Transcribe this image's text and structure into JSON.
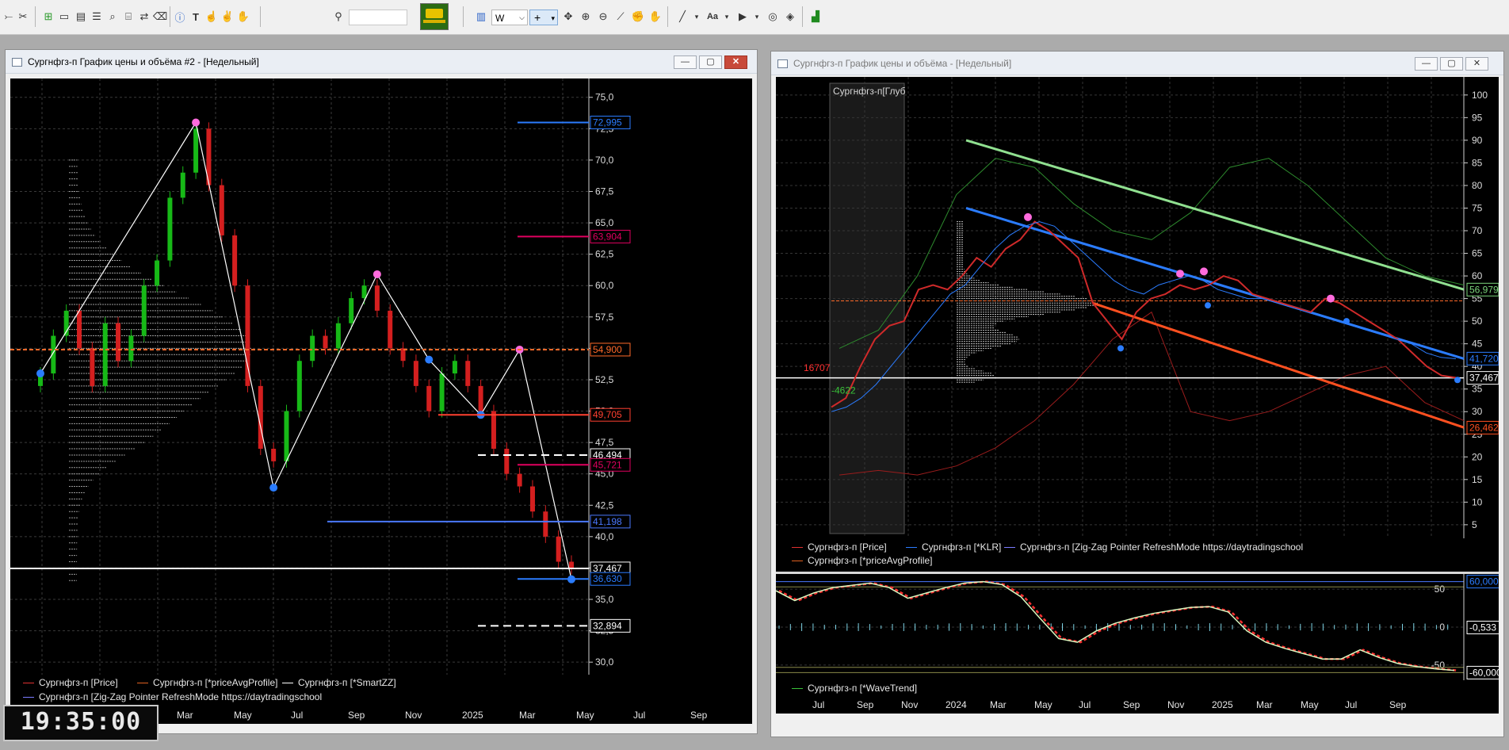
{
  "toolbar": {
    "period_value": "W",
    "icons": [
      "cursor-arrow-icon",
      "zigzag-tool-icon",
      "add-chart-icon",
      "chart-window-icon",
      "table-window-icon",
      "list-window-icon",
      "search-scan-icon",
      "script-icon",
      "transfer-icon",
      "delete-icon",
      "alert-icon",
      "text-tool-icon",
      "hand-icon",
      "fingers-icon",
      "crosshair-hand-icon",
      "search-icon",
      "ticker-image-icon",
      "bar-chart-icon",
      "crosshair-icon",
      "move-icon",
      "zoom-in-icon",
      "zoom-out-icon",
      "ruler-icon",
      "hand-grab-icon",
      "pan-icon",
      "line-tool-icon",
      "font-icon",
      "play-icon",
      "visibility-icon",
      "layers-icon",
      "indicator-icon"
    ]
  },
  "window_left": {
    "title": "Сургнфгз-п График цены и объёма #2 - [Недельный]",
    "price_ticks": [
      "75,0",
      "72,5",
      "70,0",
      "67,5",
      "65,0",
      "62,5",
      "60,0",
      "57,5",
      "55,0",
      "52,5",
      "50,0",
      "47,5",
      "45,0",
      "42,5",
      "40,0",
      "37,5",
      "35,0",
      "32,5",
      "30,0"
    ],
    "badges": [
      {
        "text": "72,995",
        "color": "#2b7cff",
        "value": 72.995
      },
      {
        "text": "63,904",
        "color": "#e0005f",
        "value": 63.904
      },
      {
        "text": "54,900",
        "color": "#ff6a2a",
        "value": 54.9
      },
      {
        "text": "49,705",
        "color": "#ff4030",
        "value": 49.705
      },
      {
        "text": "46,494",
        "color": "#ffffff",
        "value": 46.494
      },
      {
        "text": "45,721",
        "color": "#e0005f",
        "value": 45.721
      },
      {
        "text": "41,198",
        "color": "#4a78ff",
        "value": 41.198
      },
      {
        "text": "37,467",
        "color": "#ffffff",
        "value": 37.467
      },
      {
        "text": "36,630",
        "color": "#2b7cff",
        "value": 36.63
      },
      {
        "text": "32,894",
        "color": "#ffffff",
        "value": 32.894
      }
    ],
    "time_labels": [
      "Mar",
      "May",
      "Jul",
      "Sep",
      "Nov",
      "2025",
      "Mar",
      "May",
      "Jul",
      "Sep"
    ],
    "legend": [
      {
        "text": "Сургнфгз-п [Price]",
        "color": "#e03030"
      },
      {
        "text": "Сургнфгз-п [*priceAvgProfile]",
        "color": "#e06020"
      },
      {
        "text": "Сургнфгз-п [*SmartZZ]",
        "color": "#ffffff"
      },
      {
        "text": "Сургнфгз-п [Zig-Zag Pointer RefreshMode https://daytradingschool",
        "color": "#7a7aff"
      }
    ]
  },
  "window_right": {
    "title": "Сургнфгз-п График цены и объёма - [Недельный]",
    "depth_label": "Сургнфгз-п[Глуб",
    "price_ticks": [
      "100",
      "95",
      "90",
      "85",
      "80",
      "75",
      "70",
      "65",
      "60",
      "55",
      "50",
      "45",
      "40",
      "35",
      "30",
      "25",
      "20",
      "15",
      "10",
      "5"
    ],
    "badges": [
      {
        "text": "56,979",
        "color": "#7cd67c",
        "value": 56.979
      },
      {
        "text": "41,720",
        "color": "#2b7cff",
        "value": 41.72
      },
      {
        "text": "37,467",
        "color": "#ffffff",
        "value": 37.467
      },
      {
        "text": "26,462",
        "color": "#ff5020",
        "value": 26.462
      }
    ],
    "volume_labels": [
      {
        "text": "16707",
        "color": "#ff3030"
      },
      {
        "text": "-4622",
        "color": "#39c239"
      }
    ],
    "legend": [
      {
        "text": "Сургнфгз-п [Price]",
        "color": "#e03030"
      },
      {
        "text": "Сургнфгз-п [*KLR]",
        "color": "#2b7cff"
      },
      {
        "text": "Сургнфгз-п [Zig-Zag Pointer RefreshMode https://daytradingschool",
        "color": "#7a7aff"
      },
      {
        "text": "Сургнфгз-п [*priceAvgProfile]",
        "color": "#e06020"
      }
    ],
    "osc_ticks": [
      "50",
      "0",
      "-50"
    ],
    "osc_badges": [
      {
        "text": "60,000",
        "color": "#2b7cff",
        "value": 60
      },
      {
        "text": "-0,533",
        "color": "#ffffff",
        "value": -0.533
      },
      {
        "text": "-60,000",
        "color": "#ffffff",
        "value": -60
      }
    ],
    "osc_legend": {
      "text": "Сургнфгз-п [*WaveTrend]",
      "color": "#39c239"
    },
    "time_labels": [
      "Jul",
      "Sep",
      "Nov",
      "2024",
      "Mar",
      "May",
      "Jul",
      "Sep",
      "Nov",
      "2025",
      "Mar",
      "May",
      "Jul",
      "Sep"
    ]
  },
  "clock": "19:35:00",
  "chart_data": [
    {
      "type": "candlestick",
      "series": [
        {
          "name": "Сургнфгз-п [Price]",
          "values": [
            53,
            56,
            58,
            55,
            52,
            57,
            54,
            56,
            60,
            62,
            67,
            69,
            72.5,
            68,
            64,
            60,
            52,
            47,
            46,
            50,
            54,
            56,
            55,
            57,
            59,
            60,
            58,
            55,
            54,
            52,
            50,
            53,
            54,
            52,
            50,
            47,
            45,
            44,
            42,
            40,
            38,
            37.5
          ]
        }
      ],
      "swing_points": [
        53,
        72.995,
        43.9,
        60.9,
        54.1,
        49.7,
        54.9,
        36.6
      ],
      "ylim": [
        29,
        76.5
      ]
    },
    {
      "type": "line",
      "series": [
        {
          "name": "Сургнфгз-п [Price]",
          "values": [
            31,
            33,
            40,
            46,
            49,
            50,
            57,
            58,
            57,
            60,
            64,
            62,
            66,
            68,
            72,
            70,
            67,
            64,
            54,
            50,
            46,
            52,
            55,
            56,
            58,
            57,
            58,
            60,
            59,
            56,
            55,
            54,
            53,
            52,
            55,
            54,
            52,
            50,
            48,
            46,
            43,
            40,
            38,
            37.5
          ]
        },
        {
          "name": "Сургнфгз-п [*KLR]",
          "values": [
            30,
            31,
            33,
            36,
            40,
            44,
            48,
            52,
            56,
            58,
            62,
            66,
            69,
            71,
            72,
            71,
            68,
            65,
            62,
            59,
            57,
            56,
            58,
            59,
            60,
            59,
            57,
            56,
            55,
            55,
            54,
            53,
            52,
            51,
            50,
            49,
            48,
            47,
            46,
            45,
            43,
            42,
            41.7
          ]
        }
      ],
      "ylim": [
        2,
        104
      ]
    },
    {
      "type": "line",
      "series": [
        {
          "name": "Сургнфгз-п [*WaveTrend]",
          "values": [
            48,
            35,
            45,
            52,
            55,
            58,
            52,
            38,
            45,
            52,
            58,
            60,
            56,
            40,
            12,
            -15,
            -20,
            -5,
            5,
            12,
            18,
            22,
            26,
            27,
            20,
            -5,
            -20,
            -28,
            -35,
            -42,
            -42,
            -30,
            -40,
            -48,
            -52,
            -55,
            -57
          ]
        }
      ],
      "ylim": [
        -60,
        60
      ]
    }
  ]
}
